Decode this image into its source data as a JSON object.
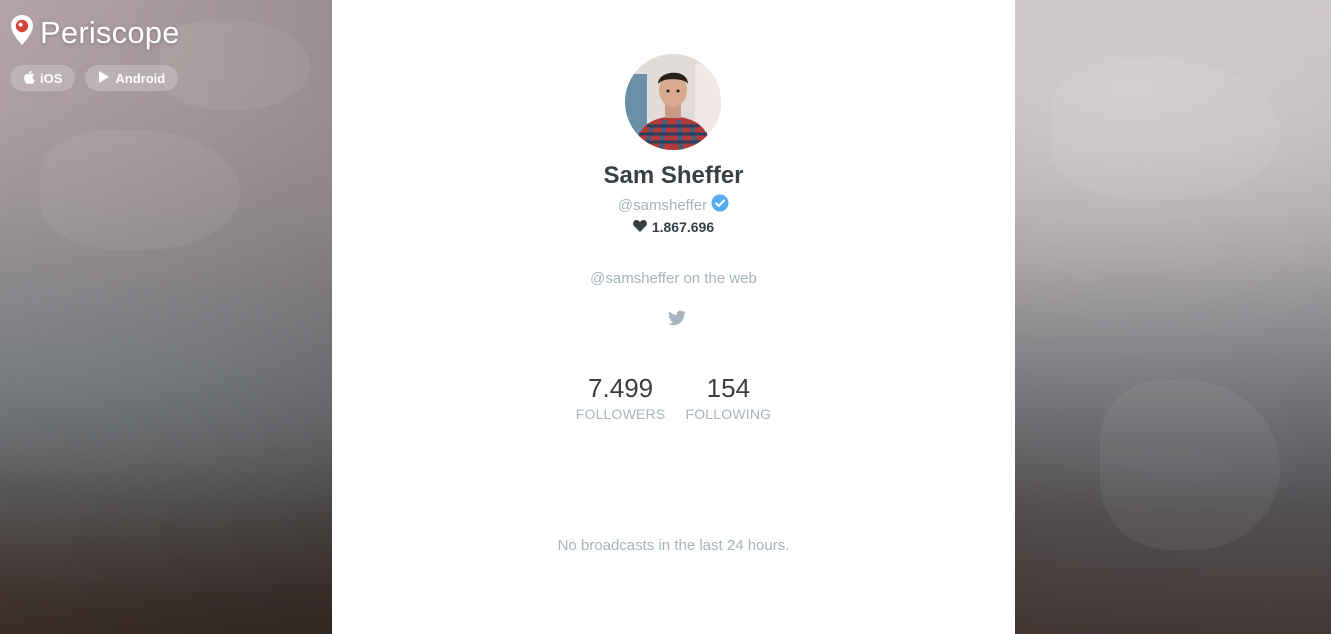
{
  "brand": {
    "title": "Periscope",
    "icon": "periscope-pin-icon"
  },
  "app_links": [
    {
      "label": "iOS",
      "icon": "apple-icon"
    },
    {
      "label": "Android",
      "icon": "play-icon"
    }
  ],
  "profile": {
    "name": "Sam Sheffer",
    "handle": "@samsheffer",
    "verified": true,
    "hearts": "1.867.696",
    "web_label": "@samsheffer on the web",
    "followers": {
      "value": "7.499",
      "label": "FOLLOWERS"
    },
    "following": {
      "value": "154",
      "label": "FOLLOWING"
    }
  },
  "broadcasts": {
    "empty_message": "No broadcasts in the last 24 hours."
  },
  "colors": {
    "brand_red": "#d6453d",
    "verified_blue": "#55acee",
    "muted_text": "#a6b4bd",
    "dark_text": "#3a3f44"
  }
}
